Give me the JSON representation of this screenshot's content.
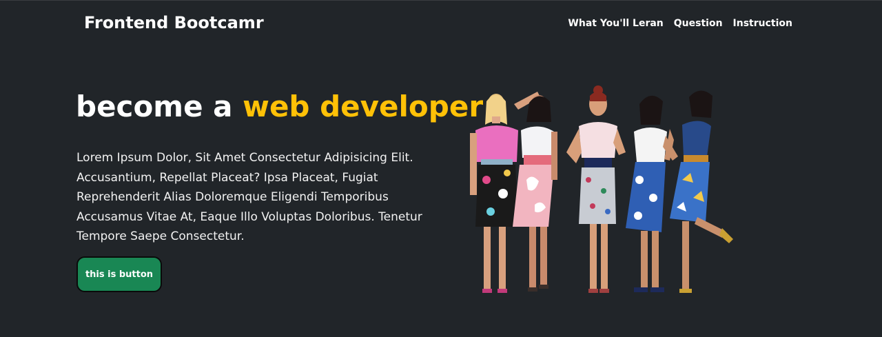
{
  "navbar": {
    "brand": "Frontend Bootcamr",
    "links": [
      {
        "label": "What You'll Leran"
      },
      {
        "label": "Question"
      },
      {
        "label": "Instruction"
      }
    ]
  },
  "hero": {
    "title_prefix": "become a ",
    "title_accent": "web developer",
    "paragraph": "Lorem Ipsum Dolor, Sit Amet Consectetur Adipisicing Elit. Accusantium, Repellat Placeat? Ipsa Placeat, Fugiat Reprehenderit Alias Doloremque Eligendi Temporibus Accusamus Vitae At, Eaque Illo Voluptas Doloribus. Tenetur Tempore Saepe Consectetur.",
    "button_label": "this is button",
    "image": {
      "subject": "five-women-illustration"
    }
  },
  "colors": {
    "background": "#212529",
    "accent": "#ffc107",
    "button": "#198754",
    "text": "#ffffff"
  }
}
